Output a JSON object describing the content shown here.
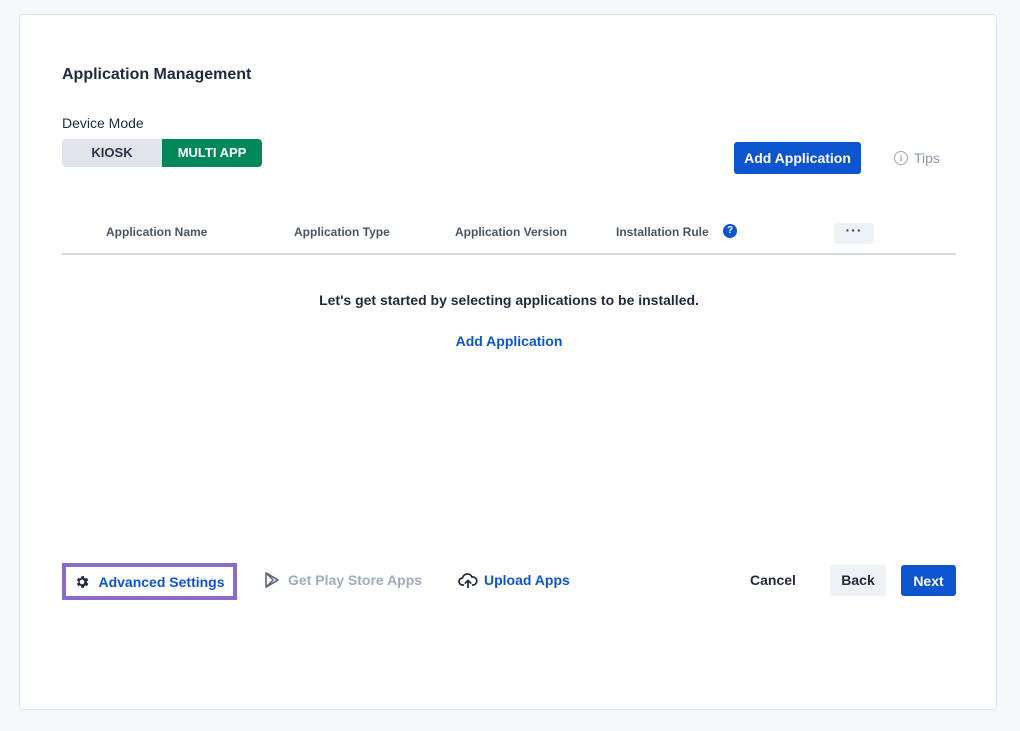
{
  "page": {
    "title": "Application Management"
  },
  "device_mode": {
    "label": "Device Mode",
    "options": [
      "KIOSK",
      "MULTI APP"
    ],
    "selected": "MULTI APP"
  },
  "toolbar": {
    "add_application": "Add Application",
    "tips": "Tips"
  },
  "table": {
    "columns": [
      "Application Name",
      "Application Type",
      "Application Version",
      "Installation Rule"
    ],
    "more_label": "···",
    "help_label": "?",
    "empty_message": "Let's get started by selecting applications to be installed.",
    "empty_link": "Add Application"
  },
  "footer": {
    "advanced_settings": "Advanced Settings",
    "play_store": "Get Play Store Apps",
    "upload_apps": "Upload Apps",
    "cancel": "Cancel",
    "back": "Back",
    "next": "Next"
  },
  "colors": {
    "primary": "#0d55cf",
    "selected_mode": "#00875a",
    "highlight_border": "#8c6ac9"
  }
}
